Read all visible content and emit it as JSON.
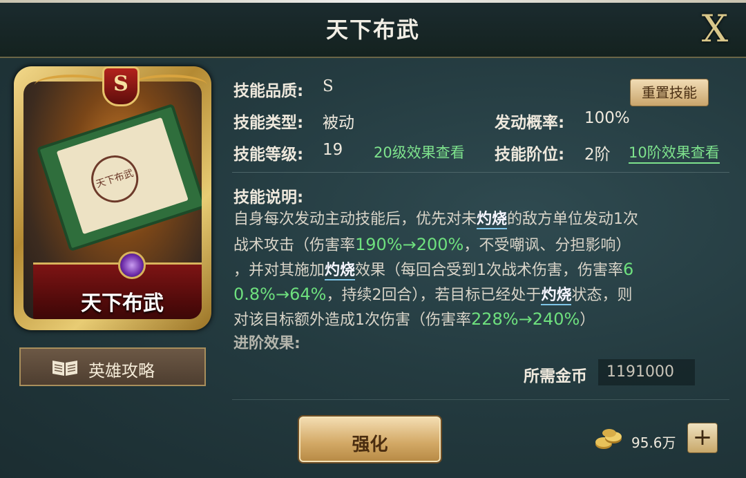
{
  "window": {
    "title": "天下布武",
    "close_label": "X"
  },
  "card": {
    "grade": "S",
    "name": "天下布武",
    "seal_text": "天下布武"
  },
  "guide_button": {
    "label": "英雄攻略",
    "icon": "book-icon"
  },
  "info": {
    "quality_label": "技能品质:",
    "quality_value": "S",
    "type_label": "技能类型:",
    "type_value": "被动",
    "level_label": "技能等级:",
    "level_value": "19",
    "level_link": "20级效果查看",
    "prob_label": "发动概率:",
    "prob_value": "100%",
    "rank_label": "技能阶位:",
    "rank_value": "2阶",
    "rank_link": "10阶效果查看",
    "reset_label": "重置技能"
  },
  "description": {
    "heading": "技能说明:",
    "lines": [
      [
        "自身每次发动主动技能后，优先对未",
        "灼烧",
        "的敌方单位发动1次"
      ],
      [
        "战术攻击（伤害率",
        "190%→200%",
        "，不受嘲讽、分担影响）"
      ],
      [
        "，并对其施加",
        "灼烧",
        "效果（每回合受到1次战术伤害，伤害率",
        "6"
      ],
      [
        "0.8%→64%",
        "，持续2回合），若目标已经处于",
        "灼烧",
        "状态，则"
      ],
      [
        "对该目标额外造成1次伤害（伤害率",
        "228%→240%",
        "）"
      ],
      [
        "进阶效果:"
      ]
    ]
  },
  "cost": {
    "label": "所需金币",
    "value": "1191000"
  },
  "enhance_button": {
    "label": "强化"
  },
  "currency": {
    "amount": "95.6万",
    "icon": "gold-coins-icon",
    "plus_label": "+"
  },
  "colors": {
    "accent_green": "#6ee07e",
    "gold": "#d8b45c",
    "keyword_underline": "#7fc6e8"
  }
}
